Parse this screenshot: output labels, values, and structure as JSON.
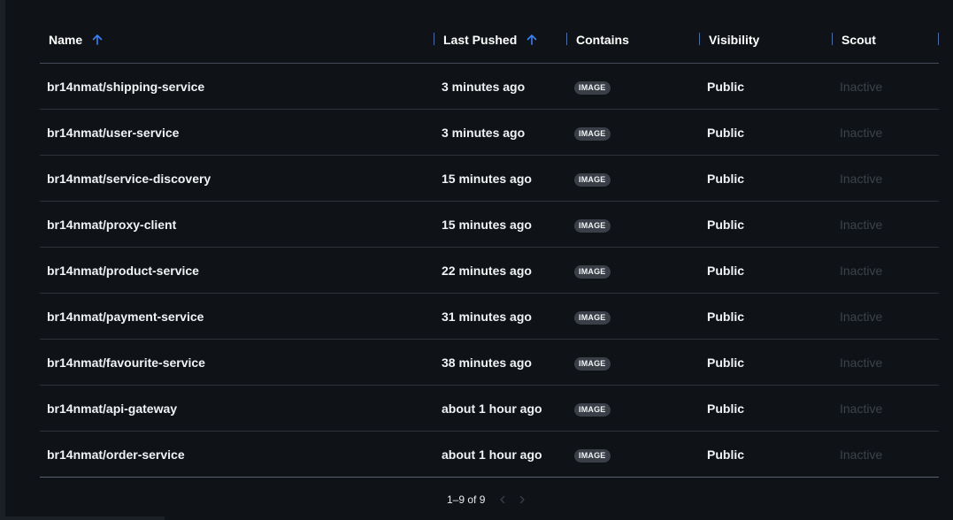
{
  "table": {
    "headers": {
      "name": "Name",
      "last_pushed": "Last Pushed",
      "contains": "Contains",
      "visibility": "Visibility",
      "scout": "Scout"
    },
    "rows": [
      {
        "name": "br14nmat/shipping-service",
        "last_pushed": "3 minutes ago",
        "contains": "IMAGE",
        "visibility": "Public",
        "scout": "Inactive"
      },
      {
        "name": "br14nmat/user-service",
        "last_pushed": "3 minutes ago",
        "contains": "IMAGE",
        "visibility": "Public",
        "scout": "Inactive"
      },
      {
        "name": "br14nmat/service-discovery",
        "last_pushed": "15 minutes ago",
        "contains": "IMAGE",
        "visibility": "Public",
        "scout": "Inactive"
      },
      {
        "name": "br14nmat/proxy-client",
        "last_pushed": "15 minutes ago",
        "contains": "IMAGE",
        "visibility": "Public",
        "scout": "Inactive"
      },
      {
        "name": "br14nmat/product-service",
        "last_pushed": "22 minutes ago",
        "contains": "IMAGE",
        "visibility": "Public",
        "scout": "Inactive"
      },
      {
        "name": "br14nmat/payment-service",
        "last_pushed": "31 minutes ago",
        "contains": "IMAGE",
        "visibility": "Public",
        "scout": "Inactive"
      },
      {
        "name": "br14nmat/favourite-service",
        "last_pushed": "38 minutes ago",
        "contains": "IMAGE",
        "visibility": "Public",
        "scout": "Inactive"
      },
      {
        "name": "br14nmat/api-gateway",
        "last_pushed": "about 1 hour ago",
        "contains": "IMAGE",
        "visibility": "Public",
        "scout": "Inactive"
      },
      {
        "name": "br14nmat/order-service",
        "last_pushed": "about 1 hour ago",
        "contains": "IMAGE",
        "visibility": "Public",
        "scout": "Inactive"
      }
    ]
  },
  "pagination": {
    "label": "1–9 of 9",
    "prev_icon": "chevron-left-icon",
    "next_icon": "chevron-right-icon"
  },
  "colors": {
    "background": "#0f1217",
    "sort_arrow": "#3b82f6",
    "inactive_text": "#3c434d"
  }
}
